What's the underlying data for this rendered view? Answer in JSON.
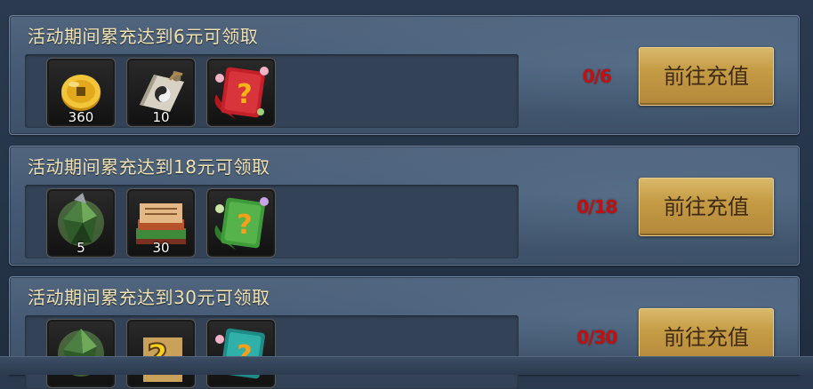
{
  "tasks": [
    {
      "title": "活动期间累充达到6元可领取",
      "progress": "0/6",
      "button_label": "前往充值",
      "rewards": [
        {
          "icon": "gold-coin-icon",
          "count": "360"
        },
        {
          "icon": "scroll-icon",
          "count": "10"
        },
        {
          "icon": "red-mystery-book-icon",
          "count": ""
        }
      ]
    },
    {
      "title": "活动期间累充达到18元可领取",
      "progress": "0/18",
      "button_label": "前往充值",
      "rewards": [
        {
          "icon": "green-crystal-icon",
          "count": "5"
        },
        {
          "icon": "book-stack-icon",
          "count": "30"
        },
        {
          "icon": "green-mystery-book-icon",
          "count": ""
        }
      ]
    },
    {
      "title": "活动期间累充达到30元可领取",
      "progress": "0/30",
      "button_label": "前往充值",
      "rewards": [
        {
          "icon": "green-crystal-icon",
          "count": ""
        },
        {
          "icon": "mystery-scroll-icon",
          "count": ""
        },
        {
          "icon": "teal-mystery-book-icon",
          "count": ""
        }
      ]
    }
  ],
  "colors": {
    "title_text": "#f1e2b2",
    "progress_text": "#c01010",
    "button_gold": "#c59b44"
  }
}
